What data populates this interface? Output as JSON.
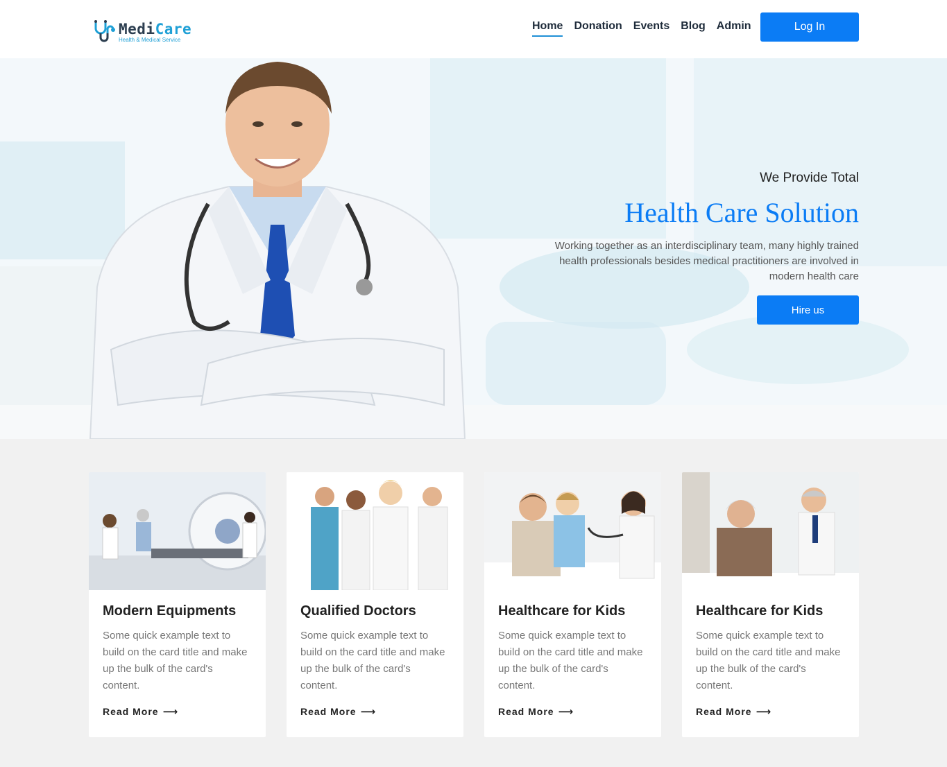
{
  "brand": {
    "name_part1": "Medi",
    "name_part2": "Care",
    "tagline": "Health & Medical Service",
    "accent": "#1fa0d6"
  },
  "nav": {
    "items": [
      {
        "label": "Home",
        "active": true
      },
      {
        "label": "Donation"
      },
      {
        "label": "Events"
      },
      {
        "label": "Blog"
      },
      {
        "label": "Admin"
      }
    ],
    "login_label": "Log In"
  },
  "hero": {
    "kicker": "We Provide Total",
    "title": "Health Care Solution",
    "description": "Working together as an interdisciplinary team, many highly trained health professionals besides medical practitioners are involved in modern health care",
    "cta_label": "Hire us"
  },
  "cards": [
    {
      "title": "Modern Equipments",
      "text": "Some quick example text to build on the card title and make up the bulk of the card's content.",
      "link": "Read More",
      "image": "radiotherapy-room"
    },
    {
      "title": "Qualified Doctors",
      "text": "Some quick example text to build on the card title and make up the bulk of the card's content.",
      "link": "Read More",
      "image": "doctor-team"
    },
    {
      "title": "Healthcare for Kids",
      "text": "Some quick example text to build on the card title and make up the bulk of the card's content.",
      "link": "Read More",
      "image": "child-checkup"
    },
    {
      "title": "Healthcare for Kids",
      "text": "Some quick example text to build on the card title and make up the bulk of the card's content.",
      "link": "Read More",
      "image": "elderly-consultation"
    }
  ],
  "colors": {
    "primary": "#0b7cf5",
    "section_bg": "#f1f1f1",
    "heading": "#1e2b3a"
  },
  "icons": {
    "logo": "stethoscope-icon",
    "read_more": "arrow-right-icon"
  }
}
